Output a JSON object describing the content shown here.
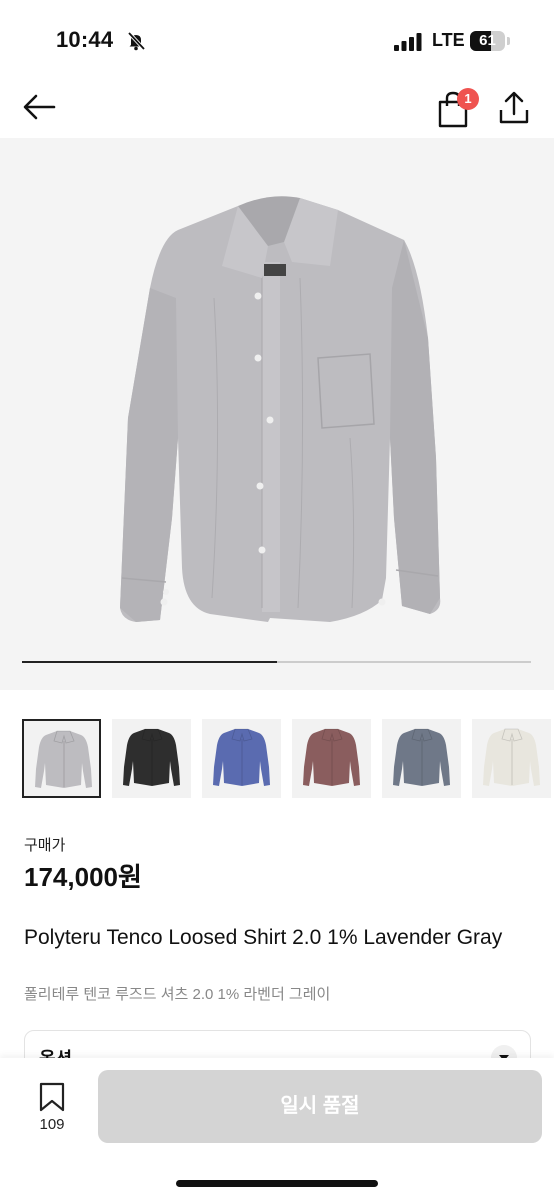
{
  "status_bar": {
    "time": "10:44",
    "network": "LTE",
    "battery_level": "61",
    "battery_fraction": 0.61
  },
  "nav": {
    "cart_badge": "1",
    "icons": [
      "arrow-left-icon",
      "shopping-bag-icon",
      "share-icon"
    ]
  },
  "gallery": {
    "progress_fraction": 0.5,
    "thumbnails": [
      {
        "name": "lavender-gray",
        "color": "#bdbcc0",
        "selected": true
      },
      {
        "name": "black",
        "color": "#2e2e2e",
        "selected": false
      },
      {
        "name": "blue",
        "color": "#5a6bb0",
        "selected": false
      },
      {
        "name": "brown",
        "color": "#8a5d5e",
        "selected": false
      },
      {
        "name": "gray-blue",
        "color": "#6f7888",
        "selected": false
      },
      {
        "name": "ivory",
        "color": "#e8e6de",
        "selected": false
      }
    ]
  },
  "product": {
    "price_label": "구매가",
    "price": "174,000원",
    "title_en": "Polyteru Tenco Loosed Shirt 2.0 1% Lavender Gray",
    "title_ko": "폴리테루 텐코 루즈드 셔츠 2.0 1% 라벤더 그레이"
  },
  "option": {
    "label": "옵션"
  },
  "bottom_bar": {
    "wishlist_count": "109",
    "buy_label": "일시 품절"
  },
  "colors": {
    "badge": "#ef5350",
    "disabled_button": "#d4d4d4"
  }
}
